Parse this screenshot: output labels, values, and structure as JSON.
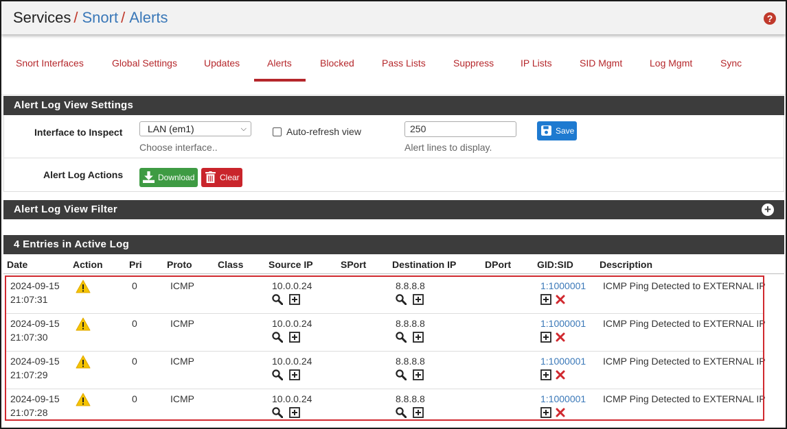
{
  "breadcrumb": {
    "root": "Services",
    "items": [
      "Snort",
      "Alerts"
    ],
    "separator": "/"
  },
  "tabs": [
    {
      "label": "Snort Interfaces"
    },
    {
      "label": "Global Settings"
    },
    {
      "label": "Updates"
    },
    {
      "label": "Alerts",
      "active": true
    },
    {
      "label": "Blocked"
    },
    {
      "label": "Pass Lists"
    },
    {
      "label": "Suppress"
    },
    {
      "label": "IP Lists"
    },
    {
      "label": "SID Mgmt"
    },
    {
      "label": "Log Mgmt"
    },
    {
      "label": "Sync"
    }
  ],
  "settings": {
    "title": "Alert Log View Settings",
    "interface_label": "Interface to Inspect",
    "interface_value": "LAN (em1)",
    "interface_hint": "Choose interface..",
    "autorefresh_label": "Auto-refresh view",
    "lines_value": "250",
    "lines_hint": "Alert lines to display.",
    "save_label": "Save",
    "actions_label": "Alert Log Actions",
    "download_label": "Download",
    "clear_label": "Clear"
  },
  "filter": {
    "title": "Alert Log View Filter"
  },
  "log": {
    "title": "4 Entries in Active Log",
    "columns": [
      "Date",
      "Action",
      "Pri",
      "Proto",
      "Class",
      "Source IP",
      "SPort",
      "Destination IP",
      "DPort",
      "GID:SID",
      "Description"
    ],
    "rows": [
      {
        "date": "2024-09-15",
        "time": "21:07:31",
        "pri": "0",
        "proto": "ICMP",
        "src": "10.0.0.24",
        "dst": "8.8.8.8",
        "sid": "1:1000001",
        "desc": "ICMP Ping Detected to EXTERNAL IP"
      },
      {
        "date": "2024-09-15",
        "time": "21:07:30",
        "pri": "0",
        "proto": "ICMP",
        "src": "10.0.0.24",
        "dst": "8.8.8.8",
        "sid": "1:1000001",
        "desc": "ICMP Ping Detected to EXTERNAL IP"
      },
      {
        "date": "2024-09-15",
        "time": "21:07:29",
        "pri": "0",
        "proto": "ICMP",
        "src": "10.0.0.24",
        "dst": "8.8.8.8",
        "sid": "1:1000001",
        "desc": "ICMP Ping Detected to EXTERNAL IP"
      },
      {
        "date": "2024-09-15",
        "time": "21:07:28",
        "pri": "0",
        "proto": "ICMP",
        "src": "10.0.0.24",
        "dst": "8.8.8.8",
        "sid": "1:1000001",
        "desc": "ICMP Ping Detected to EXTERNAL IP"
      }
    ]
  },
  "colors": {
    "tab_red": "#b5272b",
    "link_blue": "#3a78b8",
    "panel_dark": "#3c3c3c",
    "save_blue": "#1e7ad0",
    "download_green": "#3e9b43",
    "clear_red": "#c9242b",
    "warning_yellow": "#f5c400",
    "remove_red": "#d0282e"
  },
  "icons": {
    "help": "question-circle-icon",
    "save": "floppy-disk-icon",
    "download": "download-icon",
    "clear": "trash-icon",
    "filter_toggle": "plus-circle-icon",
    "action": "warning-triangle-icon",
    "lookup": "magnifier-icon",
    "add": "plus-square-icon",
    "remove": "x-icon"
  }
}
